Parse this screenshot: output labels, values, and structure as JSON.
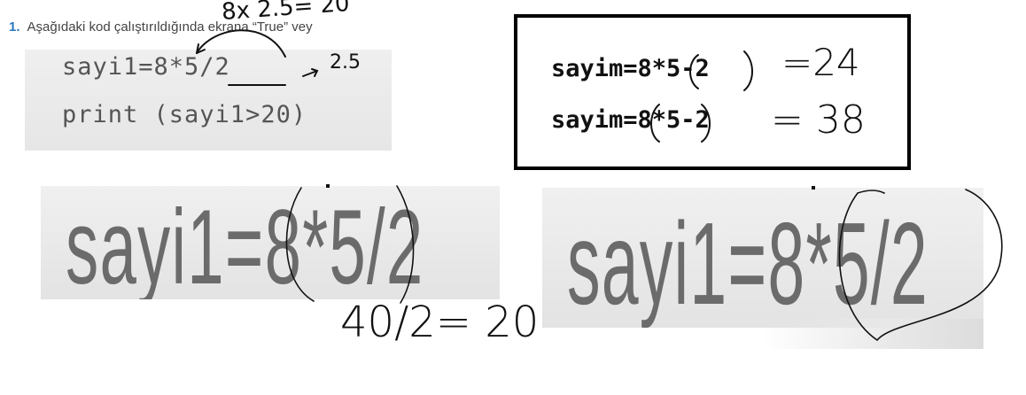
{
  "question": {
    "number": "1.",
    "text": "Aşağıdaki kod çalıştırıldığında ekrana “True” vey"
  },
  "code": {
    "line1": "sayi1=8*5/2",
    "line2": "print (sayi1>20)"
  },
  "box": {
    "line1": "sayim=8*5-2",
    "line2": "sayim=8*5-2"
  },
  "zoom": {
    "left": "sayi1=8*5/2",
    "right": "sayi1=8*5/2"
  },
  "handwriting": {
    "top": "8x 2.5= 20",
    "half": "2.5",
    "r1": "=24",
    "r2": "= 38",
    "bottom": "40/2= 20"
  }
}
